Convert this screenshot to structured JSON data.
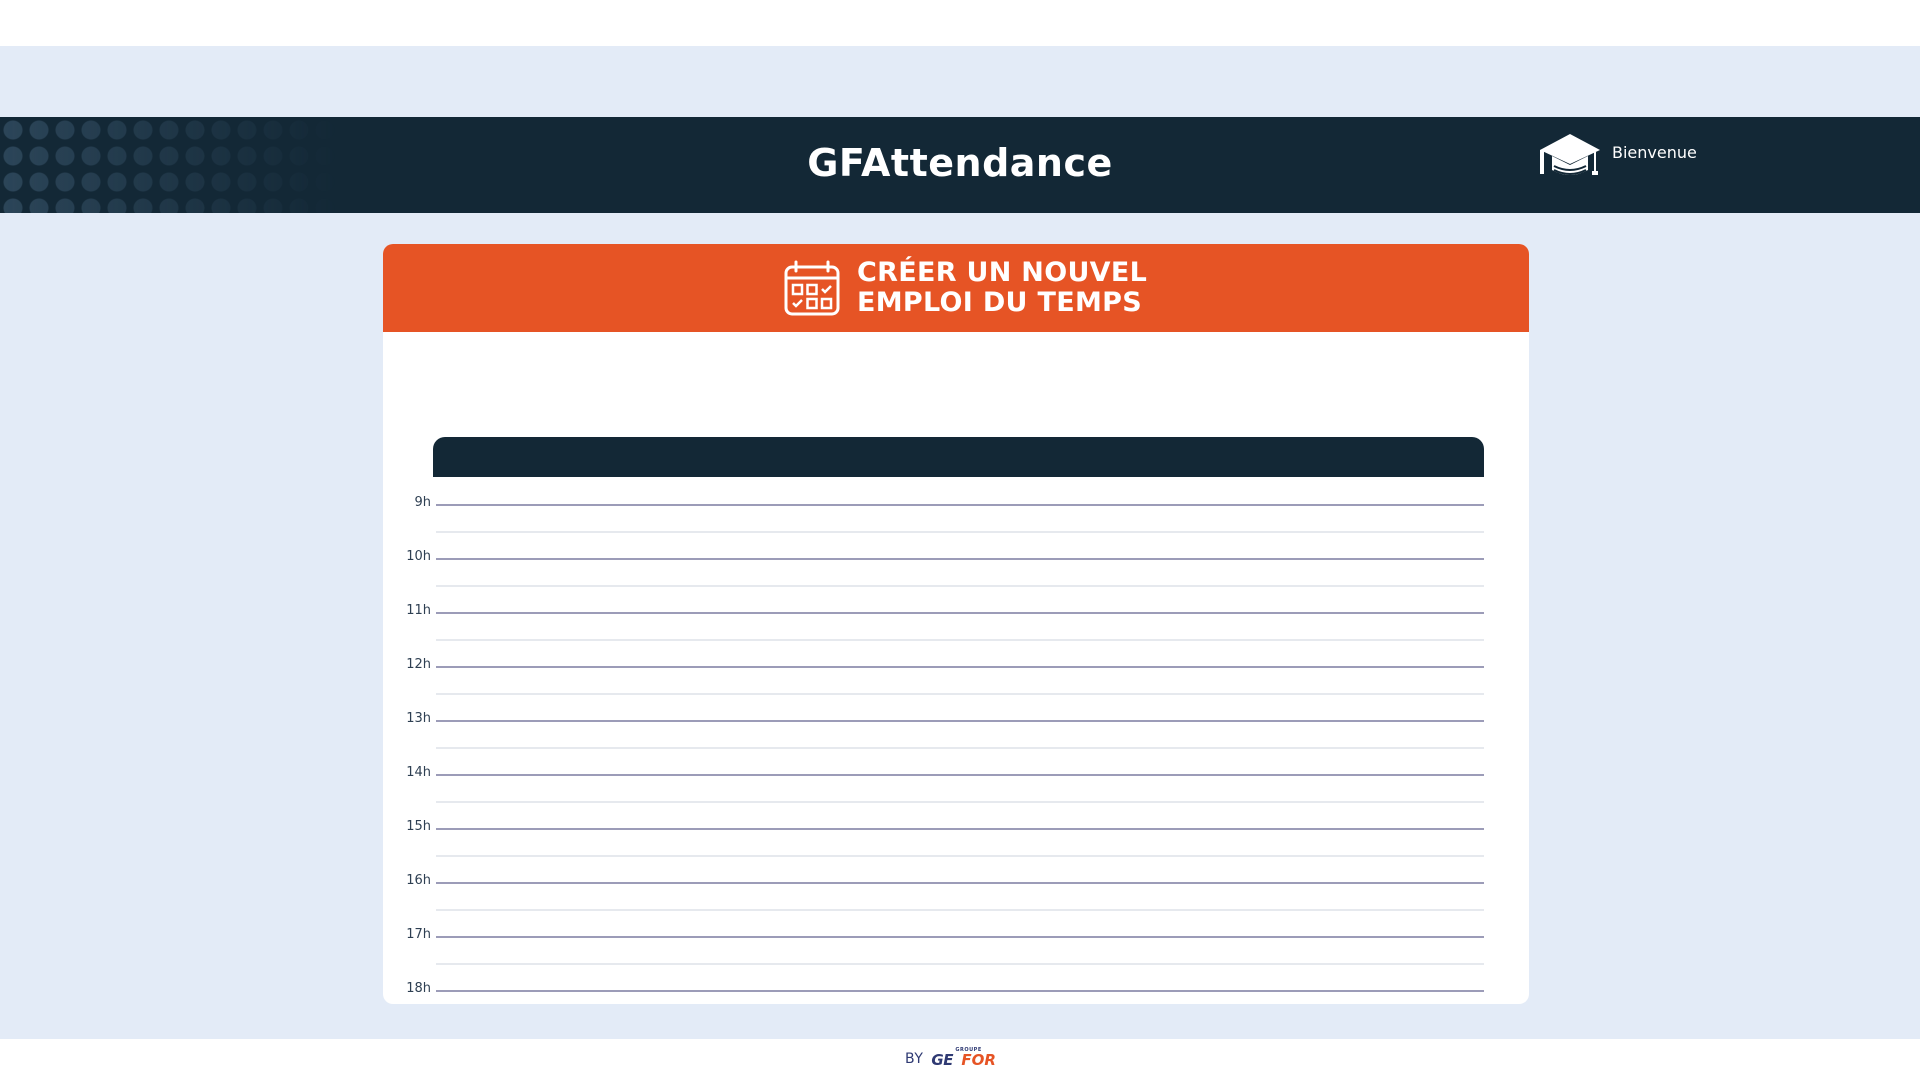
{
  "app": {
    "title": "GFAttendance",
    "welcome": "Bienvenue",
    "user_icon": "graduation-cap-icon"
  },
  "card": {
    "title_line1": "CRÉER UN NOUVEL",
    "title_line2": "EMPLOI DU TEMPS",
    "icon": "calendar-icon"
  },
  "schedule": {
    "hours": [
      "9h",
      "10h",
      "11h",
      "12h",
      "13h",
      "14h",
      "15h",
      "16h",
      "17h",
      "18h"
    ]
  },
  "footer": {
    "by": "BY",
    "brand_small": "GROUPE",
    "brand_ge": "GE",
    "brand_for": "FOR"
  },
  "colors": {
    "accent": "#e65425",
    "navy": "#132836",
    "background": "#e3ebf7"
  }
}
